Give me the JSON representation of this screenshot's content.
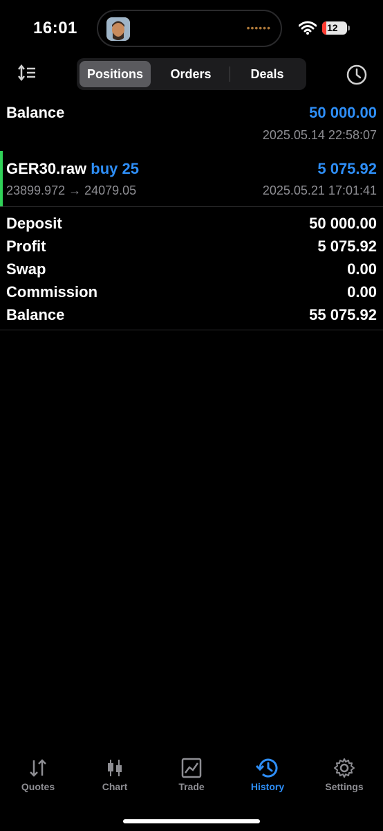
{
  "status": {
    "time": "16:01",
    "battery": "12"
  },
  "toolbar": {
    "segments": [
      "Positions",
      "Orders",
      "Deals"
    ],
    "active_segment": "Positions"
  },
  "balance_entry": {
    "label": "Balance",
    "value": "50 000.00",
    "time": "2025.05.14 22:58:07"
  },
  "trade": {
    "symbol": "GER30.raw",
    "direction": "buy 25",
    "profit": "5 075.92",
    "prices": "23899.972 → 24079.05",
    "time": "2025.05.21 17:01:41"
  },
  "summary": [
    {
      "label": "Deposit",
      "value": "50 000.00"
    },
    {
      "label": "Profit",
      "value": "5 075.92"
    },
    {
      "label": "Swap",
      "value": "0.00"
    },
    {
      "label": "Commission",
      "value": "0.00"
    },
    {
      "label": "Balance",
      "value": "55 075.92"
    }
  ],
  "tabbar": {
    "items": [
      {
        "label": "Quotes",
        "icon": "quotes-icon"
      },
      {
        "label": "Chart",
        "icon": "candles-icon"
      },
      {
        "label": "Trade",
        "icon": "trade-chart-icon"
      },
      {
        "label": "History",
        "icon": "history-icon"
      },
      {
        "label": "Settings",
        "icon": "gear-icon"
      }
    ],
    "active": "History"
  },
  "colors": {
    "accent": "#2e8ef7",
    "buy_marker": "#30d158",
    "muted": "#8e8e93"
  }
}
